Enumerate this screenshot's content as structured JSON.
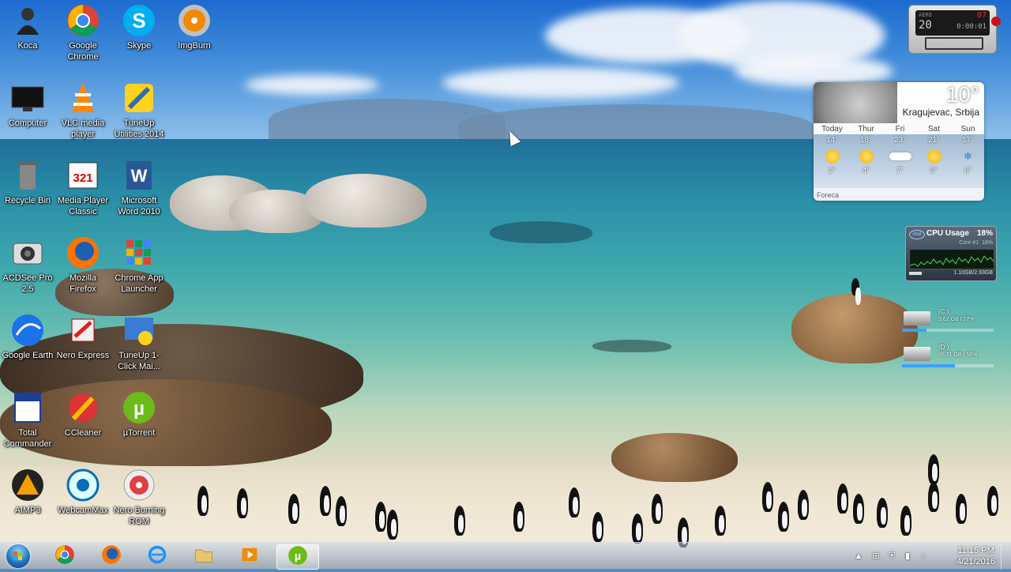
{
  "desktop": {
    "icons": [
      {
        "label": "Koca",
        "icon": "user-folder-icon"
      },
      {
        "label": "Google Chrome",
        "icon": "chrome-icon"
      },
      {
        "label": "Skype",
        "icon": "skype-icon"
      },
      {
        "label": "ImgBurn",
        "icon": "imgburn-icon"
      },
      {
        "label": "Computer",
        "icon": "computer-icon"
      },
      {
        "label": "VLC media player",
        "icon": "vlc-icon"
      },
      {
        "label": "TuneUp Utilities 2014",
        "icon": "tuneup-icon"
      },
      {
        "label": "Recycle Bin",
        "icon": "recycle-bin-icon"
      },
      {
        "label": "Media Player Classic",
        "icon": "mpc-icon"
      },
      {
        "label": "Microsoft Word 2010",
        "icon": "word-icon"
      },
      {
        "label": "ACDSee Pro 2.5",
        "icon": "acdsee-icon"
      },
      {
        "label": "Mozilla Firefox",
        "icon": "firefox-icon"
      },
      {
        "label": "Chrome App Launcher",
        "icon": "app-launcher-icon"
      },
      {
        "label": "Google Earth",
        "icon": "google-earth-icon"
      },
      {
        "label": "Nero Express",
        "icon": "nero-express-icon"
      },
      {
        "label": "TuneUp 1-Click Mai...",
        "icon": "tuneup-1click-icon"
      },
      {
        "label": "Total Commander",
        "icon": "total-commander-icon"
      },
      {
        "label": "CCleaner",
        "icon": "ccleaner-icon"
      },
      {
        "label": "µTorrent",
        "icon": "utorrent-icon"
      },
      {
        "label": "AIMP3",
        "icon": "aimp-icon"
      },
      {
        "label": "WebcamMax",
        "icon": "webcammax-icon"
      },
      {
        "label": "Nero Burning ROM",
        "icon": "nero-burning-icon"
      }
    ]
  },
  "clock_gadget": {
    "top_left": "AERO",
    "seconds": "20",
    "right_top": "07",
    "right_bottom": "0:00:01"
  },
  "weather": {
    "temp": "10°",
    "city": "Kragujevac, Srbija",
    "source": "Foreca",
    "days": [
      {
        "day": "Today",
        "hi": "14°",
        "lo": "2°",
        "cond": "sun"
      },
      {
        "day": "Thur",
        "hi": "18°",
        "lo": "4°",
        "cond": "sun"
      },
      {
        "day": "Fri",
        "hi": "23°",
        "lo": "7°",
        "cond": "cloud"
      },
      {
        "day": "Sat",
        "hi": "21°",
        "lo": "9°",
        "cond": "sun"
      },
      {
        "day": "Sun",
        "hi": "17°",
        "lo": "6°",
        "cond": "snow"
      }
    ]
  },
  "cpu": {
    "title": "CPU Usage",
    "percent": "18%",
    "core": "Core #1",
    "core_percent": "18%",
    "memory": "1.10GB/2.93GB",
    "brand": "intel"
  },
  "drives": [
    {
      "label": "(C:)",
      "stats": "9.62 GB / 27%",
      "used": 0.27
    },
    {
      "label": "(D:)",
      "stats": "65.71 GB / 58%",
      "used": 0.58
    }
  ],
  "taskbar": {
    "buttons": [
      {
        "name": "chrome",
        "icon": "chrome-icon"
      },
      {
        "name": "firefox",
        "icon": "firefox-icon"
      },
      {
        "name": "internet-explorer",
        "icon": "ie-icon"
      },
      {
        "name": "explorer",
        "icon": "folder-icon"
      },
      {
        "name": "media",
        "icon": "media-player-icon"
      },
      {
        "name": "utorrent",
        "icon": "utorrent-icon"
      }
    ],
    "time": "11:15 PM",
    "date": "4/21/2016"
  }
}
